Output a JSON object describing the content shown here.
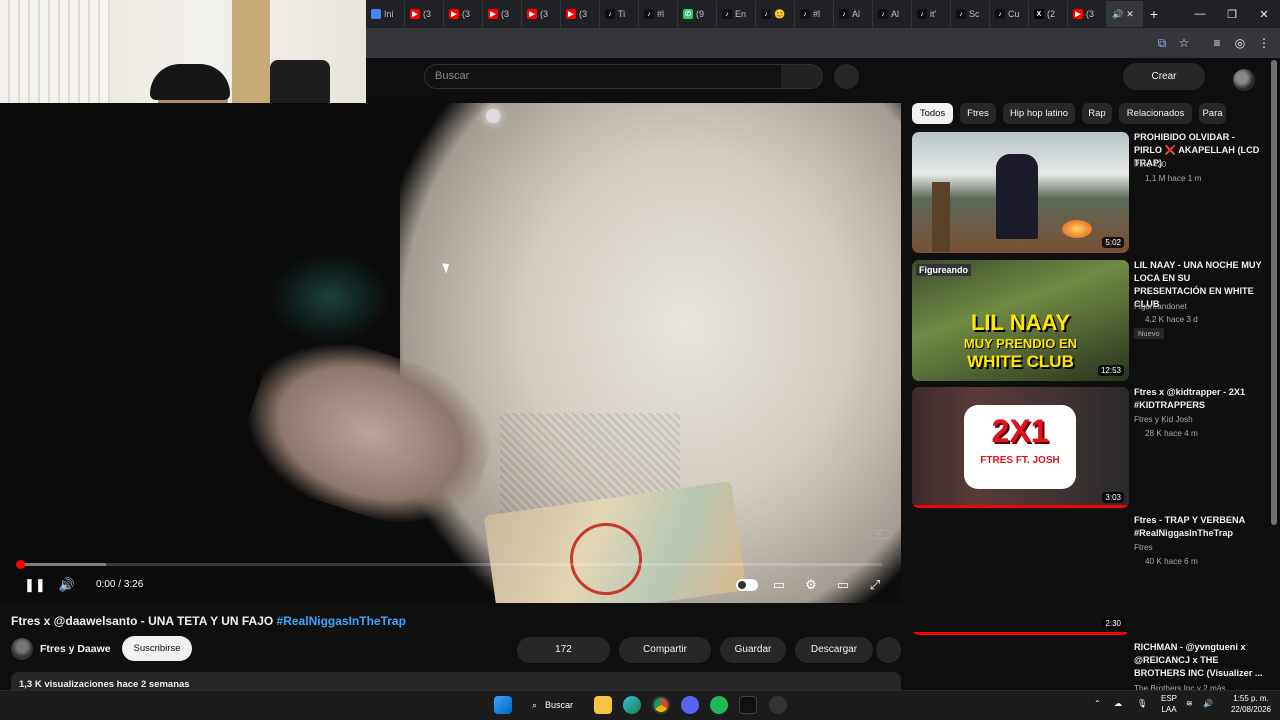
{
  "browser": {
    "tabs": [
      {
        "label": "Ini",
        "color": "#4285f4",
        "glyph": ""
      },
      {
        "label": "(3",
        "color": "#ff0000",
        "glyph": "▶"
      },
      {
        "label": "(3",
        "color": "#ff0000",
        "glyph": "▶"
      },
      {
        "label": "(3",
        "color": "#ff0000",
        "glyph": "▶"
      },
      {
        "label": "(3",
        "color": "#ff0000",
        "glyph": "▶"
      },
      {
        "label": "(3",
        "color": "#ff0000",
        "glyph": "▶"
      },
      {
        "label": "Ti",
        "color": "#111111",
        "glyph": "♪"
      },
      {
        "label": "#l",
        "color": "#111111",
        "glyph": "♪"
      },
      {
        "label": "(9",
        "color": "#25d366",
        "glyph": "✆"
      },
      {
        "label": "En",
        "color": "#111111",
        "glyph": "♪"
      },
      {
        "label": "😊",
        "color": "#111111",
        "glyph": "♪"
      },
      {
        "label": "#l",
        "color": "#111111",
        "glyph": "♪"
      },
      {
        "label": "Al",
        "color": "#111111",
        "glyph": "♪"
      },
      {
        "label": "Al",
        "color": "#111111",
        "glyph": "♪"
      },
      {
        "label": "it'",
        "color": "#111111",
        "glyph": "♪"
      },
      {
        "label": "Sc",
        "color": "#111111",
        "glyph": "♪"
      },
      {
        "label": "Cu",
        "color": "#111111",
        "glyph": "♪"
      },
      {
        "label": "(2",
        "color": "#000000",
        "glyph": "X"
      },
      {
        "label": "(3",
        "color": "#ff0000",
        "glyph": "▶"
      }
    ],
    "active_tab_glyph": "🔊",
    "active_tab_close": "✕",
    "new_tab": "+",
    "window_controls": {
      "minimize": "—",
      "maximize": "❐",
      "close": "✕"
    }
  },
  "youtube": {
    "search_placeholder": "Buscar",
    "create_label": "Crear"
  },
  "player": {
    "current_time": "0:00",
    "separator": " / ",
    "duration": "3:26",
    "progress": 0.0,
    "buffered": 0.1,
    "colors": {
      "played": "#ff0000"
    }
  },
  "video": {
    "title_main": "Ftres x @daawelsanto - UNA TETA Y UN FAJO ",
    "title_hashtag": "#RealNiggasInTheTrap",
    "channel": "Ftres y Daawe",
    "subscribe": "Suscribirse",
    "likes": "172",
    "share": "Compartir",
    "save": "Guardar",
    "download": "Descargar",
    "views_line": "1,3 K visualizaciones  hace 2 semanas"
  },
  "chips": [
    "Todos",
    "Ftres",
    "Hip hop latino",
    "Rap",
    "Relacionados",
    "Para"
  ],
  "related": [
    {
      "title": "PROHIBIDO OLVIDAR - PIRLO ❌ AKAPELLAH (LCD TRAP)",
      "channel": "Pirlo 420",
      "meta": "1,1 M  hace 1 m",
      "duration": "5:02"
    },
    {
      "title": "LIL NAAY - UNA NOCHE MUY LOCA EN SU PRESENTACIÓN EN WHITE CLUB",
      "channel": "Figureandonet",
      "meta": "4,2 K  hace 3 d",
      "duration": "12:53",
      "badge": "Nuevo"
    },
    {
      "title": "Ftres x @kidtrapper  - 2X1 #KIDTRAPPERS",
      "channel": "Ftres y Kid Josh",
      "meta": "28 K  hace 4 m",
      "duration": "3:03"
    },
    {
      "title": "Ftres - TRAP Y VERBENA #RealNiggasInTheTrap",
      "channel": "Ftres",
      "meta": "40 K  hace 6 m",
      "duration": "2:30"
    },
    {
      "title": "RICHMAN - @yvngtueni x @REICANCJ x THE BROTHERS INC (Visualizer ...",
      "channel": "The Brothers Inc y 2 más",
      "meta": "",
      "duration": ""
    }
  ],
  "thumb_texts": {
    "t2_line1": "LIL NAAY",
    "t2_line2": "MUY PRENDIO EN",
    "t2_line3": "WHITE CLUB",
    "t2_brand": "Figureando",
    "t3_big": "2X1",
    "t3_sub": "FTRES FT. JOSH"
  },
  "taskbar": {
    "search": "Buscar",
    "lang_top": "ESP",
    "lang_bottom": "LAA",
    "time": "1:55 p. m.",
    "date": "22/08/2026"
  }
}
